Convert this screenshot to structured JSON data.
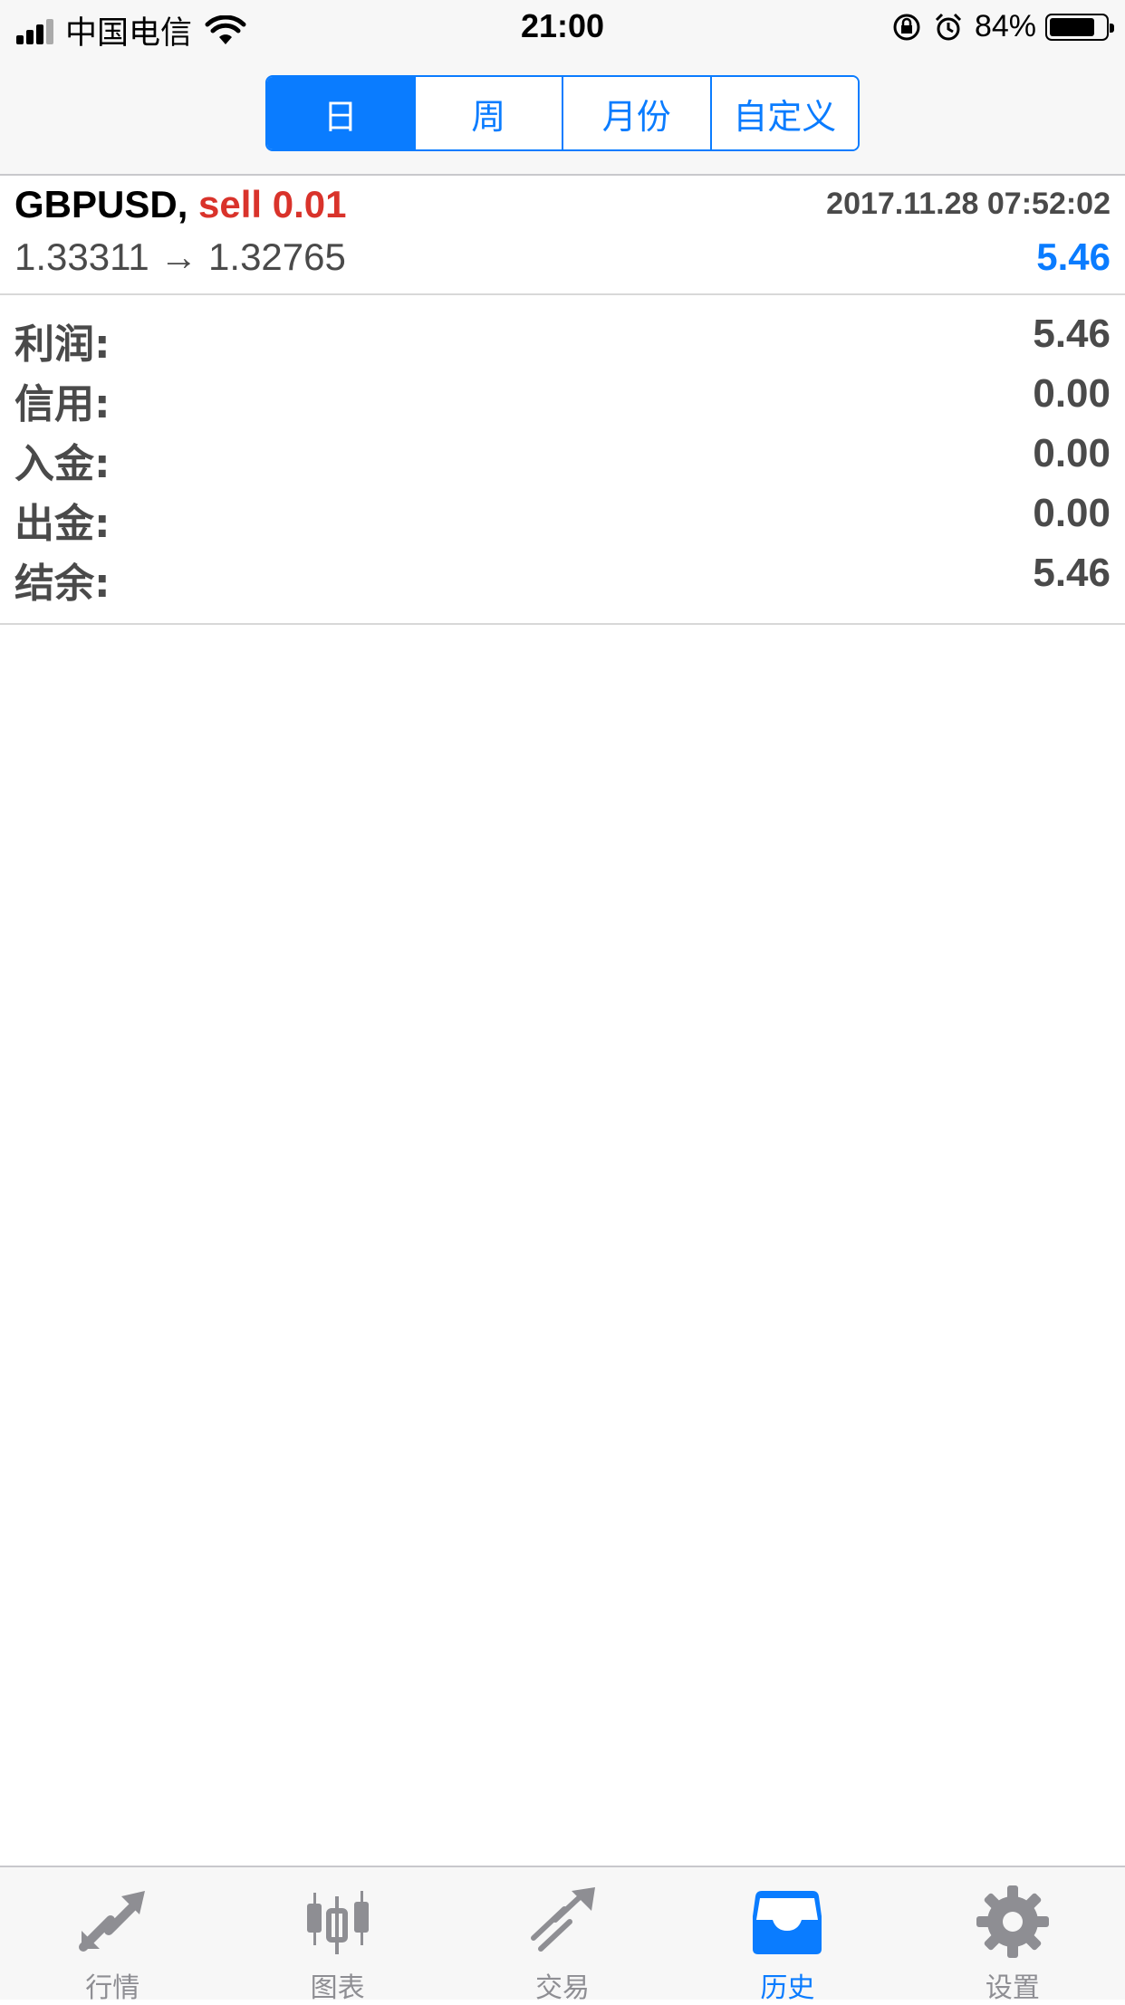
{
  "status_bar": {
    "carrier": "中国电信",
    "time": "21:00",
    "battery": "84%",
    "battery_level": 0.84
  },
  "period_tabs": [
    {
      "label": "日",
      "active": true
    },
    {
      "label": "周",
      "active": false
    },
    {
      "label": "月份",
      "active": false
    },
    {
      "label": "自定义",
      "active": false
    }
  ],
  "trade": {
    "symbol": "GBPUSD,",
    "side": "sell 0.01",
    "datetime": "2017.11.28 07:52:02",
    "prices": "1.33311 → 1.32765",
    "profit": "5.46"
  },
  "summary": [
    {
      "label": "利润:",
      "value": "5.46"
    },
    {
      "label": "信用:",
      "value": "0.00"
    },
    {
      "label": "入金:",
      "value": "0.00"
    },
    {
      "label": "出金:",
      "value": "0.00"
    },
    {
      "label": "结余:",
      "value": "5.46"
    }
  ],
  "tab_bar": [
    {
      "label": "行情",
      "icon": "quotes-arrows-icon",
      "active": false
    },
    {
      "label": "图表",
      "icon": "candlestick-chart-icon",
      "active": false
    },
    {
      "label": "交易",
      "icon": "trade-trend-icon",
      "active": false
    },
    {
      "label": "历史",
      "icon": "history-inbox-icon",
      "active": true
    },
    {
      "label": "设置",
      "icon": "gear-icon",
      "active": false
    }
  ],
  "colors": {
    "accent": "#0a7cff",
    "sell": "#d9332b",
    "inactive_icon": "#8e8e93"
  }
}
